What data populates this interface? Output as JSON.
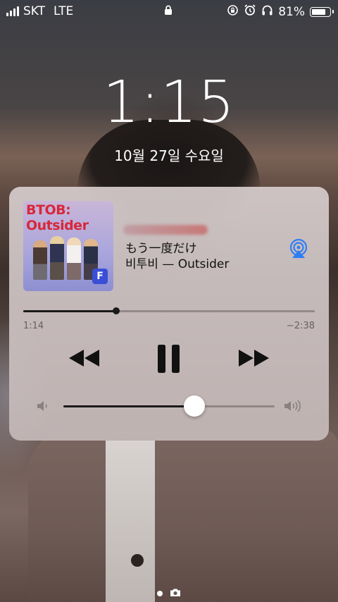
{
  "status_bar": {
    "carrier": "SKT",
    "network": "LTE",
    "battery_text": "81%",
    "battery_level": 0.81,
    "icons": [
      "signal-icon",
      "lock-icon",
      "rotation-lock-icon",
      "alarm-icon",
      "headphones-icon",
      "battery-icon"
    ]
  },
  "lock_screen": {
    "time": "1:15",
    "date": "10월 27일 수요일"
  },
  "now_playing": {
    "album_title": "BTOB: Outsider",
    "album_badge": "F",
    "song_title": "もう一度だけ",
    "artist_album": "비투비 — Outsider",
    "elapsed": "1:14",
    "remaining": "−2:38",
    "progress": 0.32,
    "volume": 0.62,
    "controls": [
      "rewind-icon",
      "pause-icon",
      "fast-forward-icon"
    ],
    "airplay_color": "#2f7df6"
  },
  "page_indicator": {
    "icons": [
      "page-dot",
      "camera-icon"
    ]
  }
}
